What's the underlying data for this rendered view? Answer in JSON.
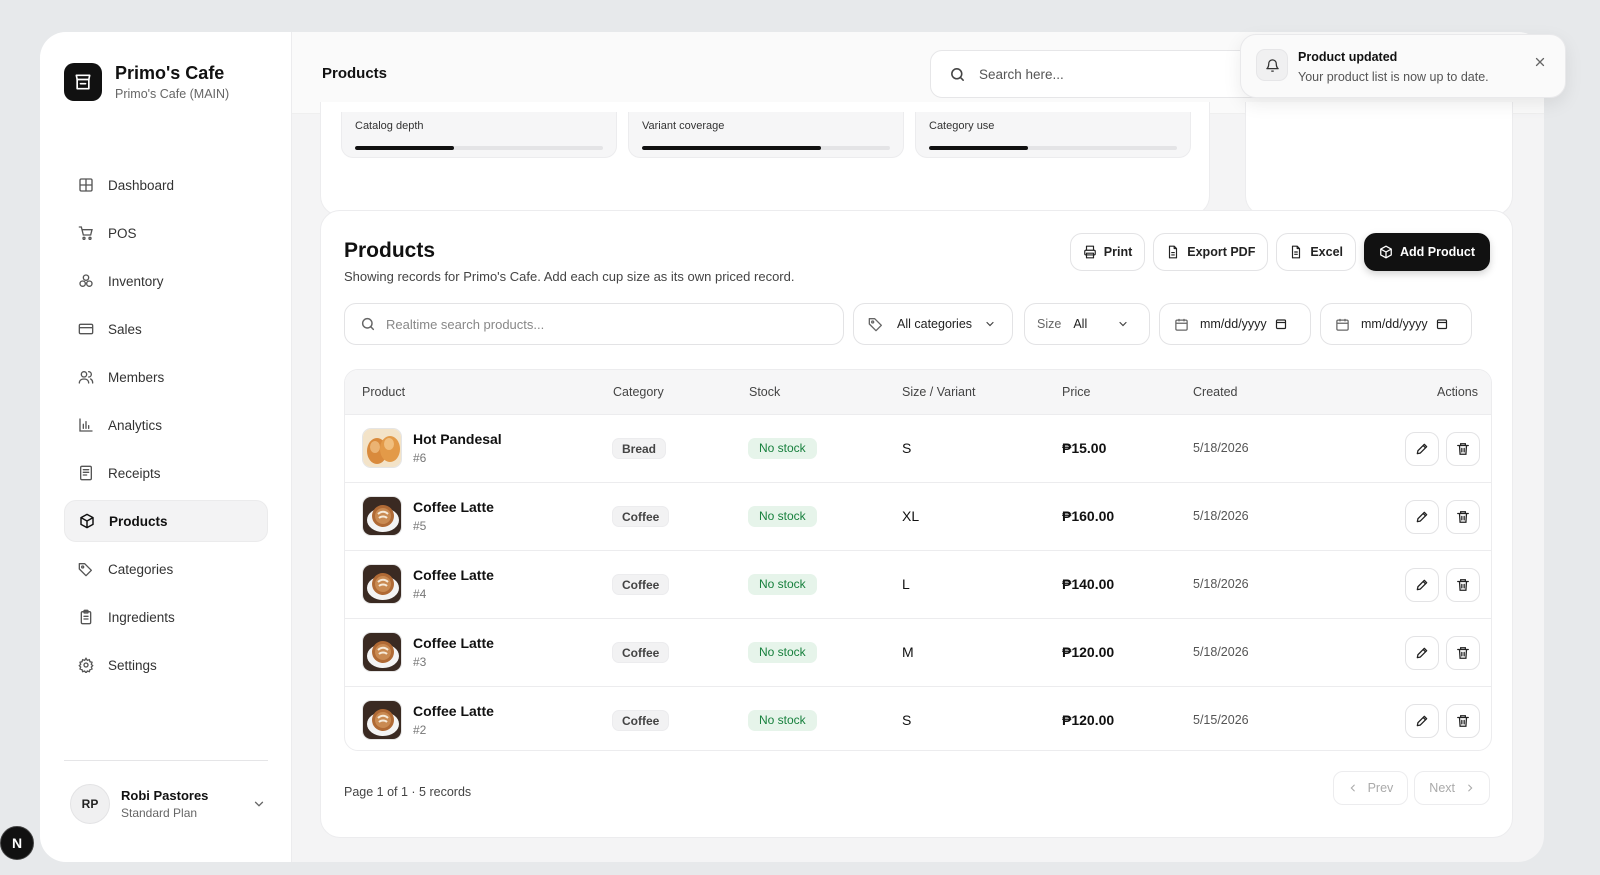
{
  "brand": {
    "name": "Primo's Cafe",
    "branch": "Primo's Cafe (MAIN)"
  },
  "sidebar": {
    "items": [
      {
        "label": "Dashboard",
        "icon": "grid-icon"
      },
      {
        "label": "POS",
        "icon": "cart-icon"
      },
      {
        "label": "Inventory",
        "icon": "boxes-icon"
      },
      {
        "label": "Sales",
        "icon": "card-icon"
      },
      {
        "label": "Members",
        "icon": "users-icon"
      },
      {
        "label": "Analytics",
        "icon": "bar-chart-icon"
      },
      {
        "label": "Receipts",
        "icon": "receipt-icon"
      },
      {
        "label": "Products",
        "icon": "package-icon",
        "active": true
      },
      {
        "label": "Categories",
        "icon": "tags-icon"
      },
      {
        "label": "Ingredients",
        "icon": "clipboard-icon"
      },
      {
        "label": "Settings",
        "icon": "gear-icon"
      }
    ]
  },
  "user": {
    "initials": "RP",
    "name": "Robi Pastores",
    "plan": "Standard Plan"
  },
  "topbar": {
    "title": "Products",
    "search_placeholder": "Search here..."
  },
  "metrics": [
    {
      "label": "Catalog depth",
      "fill": 0.4
    },
    {
      "label": "Variant coverage",
      "fill": 0.72
    },
    {
      "label": "Category use",
      "fill": 0.4
    }
  ],
  "products_card": {
    "title": "Products",
    "subtitle": "Showing records for Primo's Cafe. Add each cup size as its own priced record.",
    "buttons": {
      "print": "Print",
      "export_pdf": "Export PDF",
      "excel": "Excel",
      "add": "Add Product"
    }
  },
  "filters": {
    "search_placeholder": "Realtime search products...",
    "category": "All categories",
    "size_label": "Size",
    "size_value": "All",
    "date_from": "mm/dd/yyyy",
    "date_to": "mm/dd/yyyy"
  },
  "table": {
    "columns": [
      "Product",
      "Category",
      "Stock",
      "Size / Variant",
      "Price",
      "Created",
      "Actions"
    ],
    "rows": [
      {
        "name": "Hot Pandesal",
        "id": "#6",
        "category": "Bread",
        "stock": "No stock",
        "size": "S",
        "price": "₱15.00",
        "created": "5/18/2026",
        "thumb": "bread"
      },
      {
        "name": "Coffee Latte",
        "id": "#5",
        "category": "Coffee",
        "stock": "No stock",
        "size": "XL",
        "price": "₱160.00",
        "created": "5/18/2026",
        "thumb": "coffee"
      },
      {
        "name": "Coffee Latte",
        "id": "#4",
        "category": "Coffee",
        "stock": "No stock",
        "size": "L",
        "price": "₱140.00",
        "created": "5/18/2026",
        "thumb": "coffee"
      },
      {
        "name": "Coffee Latte",
        "id": "#3",
        "category": "Coffee",
        "stock": "No stock",
        "size": "M",
        "price": "₱120.00",
        "created": "5/18/2026",
        "thumb": "coffee"
      },
      {
        "name": "Coffee Latte",
        "id": "#2",
        "category": "Coffee",
        "stock": "No stock",
        "size": "S",
        "price": "₱120.00",
        "created": "5/15/2026",
        "thumb": "coffee"
      }
    ]
  },
  "pagination": {
    "summary": "Page 1 of 1 · 5 records",
    "prev": "Prev",
    "next": "Next"
  },
  "toast": {
    "title": "Product updated",
    "message": "Your product list is now up to date."
  },
  "dev_badge": "N",
  "colors": {
    "accent": "#111111",
    "stock_bg": "#e6f4ea",
    "stock_text": "#17803d",
    "page_bg": "#e7e9eb"
  }
}
